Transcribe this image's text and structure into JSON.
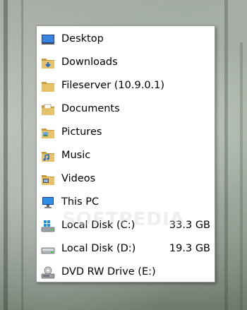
{
  "menu": {
    "items": [
      {
        "label": "Desktop",
        "icon": "desktop-icon"
      },
      {
        "label": "Downloads",
        "icon": "downloads-folder-icon"
      },
      {
        "label": "Fileserver (10.9.0.1)",
        "icon": "folder-icon"
      },
      {
        "label": "Documents",
        "icon": "documents-folder-icon"
      },
      {
        "label": "Pictures",
        "icon": "pictures-folder-icon"
      },
      {
        "label": "Music",
        "icon": "music-folder-icon"
      },
      {
        "label": "Videos",
        "icon": "videos-folder-icon"
      },
      {
        "label": "This PC",
        "icon": "this-pc-icon"
      },
      {
        "label": "Local Disk (C:)",
        "size": "33.3 GB",
        "icon": "windows-drive-icon"
      },
      {
        "label": "Local Disk (D:)",
        "size": "19.3 GB",
        "icon": "drive-icon"
      },
      {
        "label": "DVD RW Drive (E:)",
        "icon": "dvd-drive-icon"
      }
    ]
  },
  "watermark": "SOFTPEDIA",
  "colors": {
    "folder": "#e8c268",
    "folder_dark": "#c99a3a",
    "accent_blue": "#1c6fd1"
  }
}
